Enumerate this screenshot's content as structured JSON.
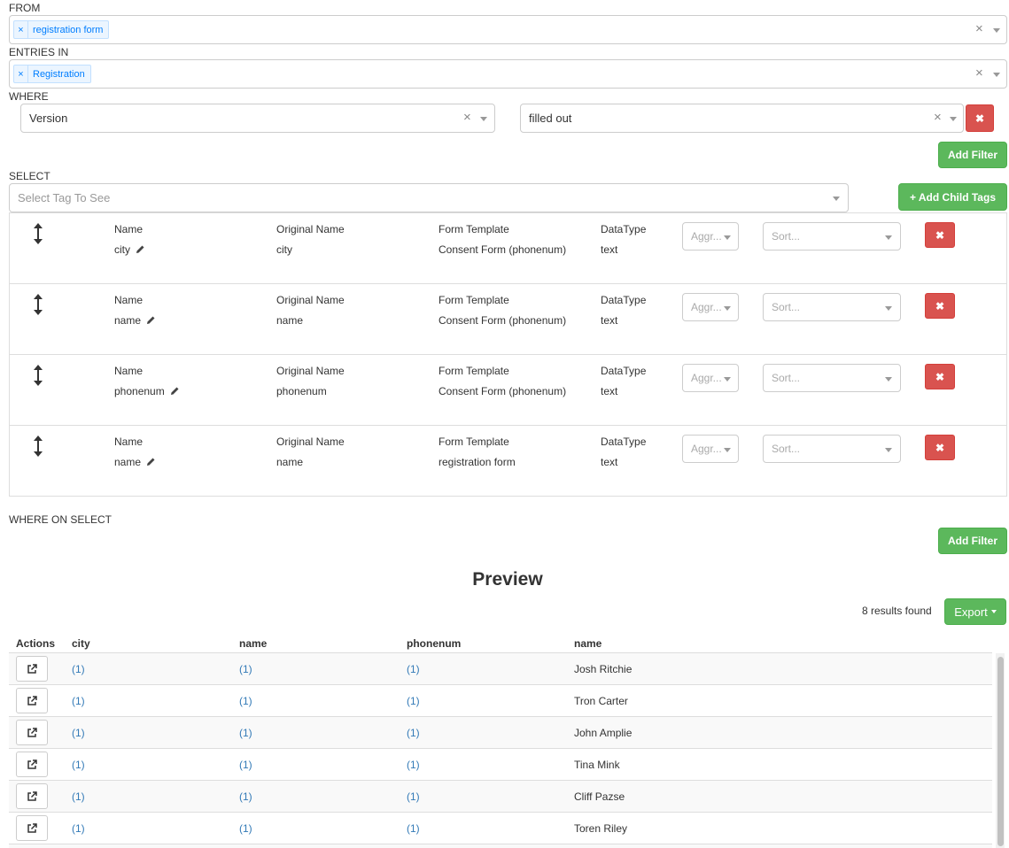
{
  "from": {
    "label": "FROM",
    "tag": "registration form",
    "tag_remove": "×",
    "clear": "×"
  },
  "entries": {
    "label": "ENTRIES IN",
    "tag": "Registration",
    "tag_remove": "×",
    "clear": "×"
  },
  "where": {
    "label": "WHERE",
    "field_value": "Version",
    "operator_value": "filled out",
    "clear": "×",
    "remove_label": "✖",
    "add_filter_label": "Add Filter"
  },
  "select": {
    "label": "SELECT",
    "placeholder": "Select Tag To See",
    "add_child_tags_label": "+ Add Child Tags"
  },
  "tag_columns": {
    "name": "Name",
    "original_name": "Original Name",
    "form_template": "Form Template",
    "datatype": "DataType",
    "aggr_placeholder": "Aggr...",
    "sort_placeholder": "Sort..."
  },
  "tag_rows": [
    {
      "name": "city",
      "original_name": "city",
      "form_template": "Consent Form (phonenum)",
      "datatype": "text"
    },
    {
      "name": "name",
      "original_name": "name",
      "form_template": "Consent Form (phonenum)",
      "datatype": "text"
    },
    {
      "name": "phonenum",
      "original_name": "phonenum",
      "form_template": "Consent Form (phonenum)",
      "datatype": "text"
    },
    {
      "name": "name",
      "original_name": "name",
      "form_template": "registration form",
      "datatype": "text"
    }
  ],
  "where_on_select": {
    "label": "WHERE ON SELECT",
    "add_filter_label": "Add Filter"
  },
  "preview": {
    "title": "Preview",
    "results_text": "8 results found",
    "export_label": "Export",
    "headers": [
      "Actions",
      "city",
      "name",
      "phonenum",
      "name"
    ],
    "rows": [
      [
        "(1)",
        "(1)",
        "(1)",
        "Josh Ritchie"
      ],
      [
        "(1)",
        "(1)",
        "(1)",
        "Tron Carter"
      ],
      [
        "(1)",
        "(1)",
        "(1)",
        "John Amplie"
      ],
      [
        "(1)",
        "(1)",
        "(1)",
        "Tina Mink"
      ],
      [
        "(1)",
        "(1)",
        "(1)",
        "Cliff Pazse"
      ],
      [
        "(1)",
        "(1)",
        "(1)",
        "Toren Riley"
      ]
    ]
  },
  "colors": {
    "success": "#5cb85c",
    "danger": "#d9534f",
    "link": "#337ab7",
    "tag_text": "#007eff"
  },
  "icons": {
    "move": "vertical-arrows-icon",
    "edit": "pencil-icon",
    "open": "external-link-icon",
    "remove": "times-icon"
  }
}
